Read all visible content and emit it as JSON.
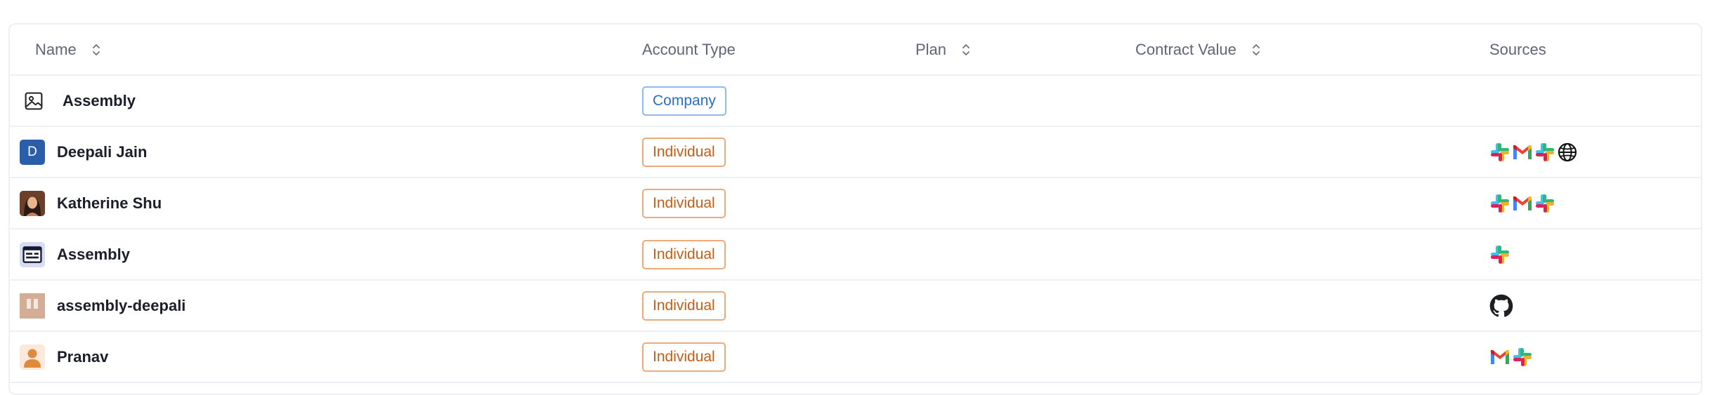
{
  "columns": {
    "name": "Name",
    "account_type": "Account Type",
    "plan": "Plan",
    "contract_value": "Contract Value",
    "sources": "Sources"
  },
  "rows": [
    {
      "name": "Assembly",
      "avatar": "image-placeholder-icon",
      "account_type": "Company",
      "plan": "",
      "contract_value": "",
      "sources": []
    },
    {
      "name": "Deepali Jain",
      "avatar": "initial-avatar",
      "initial": "D",
      "account_type": "Individual",
      "plan": "",
      "contract_value": "",
      "sources": [
        "slack",
        "gmail",
        "slack",
        "globe"
      ]
    },
    {
      "name": "Katherine Shu",
      "avatar": "photo-avatar",
      "account_type": "Individual",
      "plan": "",
      "contract_value": "",
      "sources": [
        "slack",
        "gmail",
        "slack"
      ]
    },
    {
      "name": "Assembly",
      "avatar": "app-window-avatar",
      "account_type": "Individual",
      "plan": "",
      "contract_value": "",
      "sources": [
        "slack"
      ]
    },
    {
      "name": "assembly-deepali",
      "avatar": "board-avatar",
      "account_type": "Individual",
      "plan": "",
      "contract_value": "",
      "sources": [
        "github"
      ]
    },
    {
      "name": "Pranav",
      "avatar": "person-avatar",
      "account_type": "Individual",
      "plan": "",
      "contract_value": "",
      "sources": [
        "gmail",
        "slack"
      ]
    }
  ],
  "colors": {
    "company_badge": "#2b6fc3",
    "individual_badge": "#c55d16",
    "initial_avatar_bg": "#2a5ea8",
    "border": "#edf0f4"
  }
}
